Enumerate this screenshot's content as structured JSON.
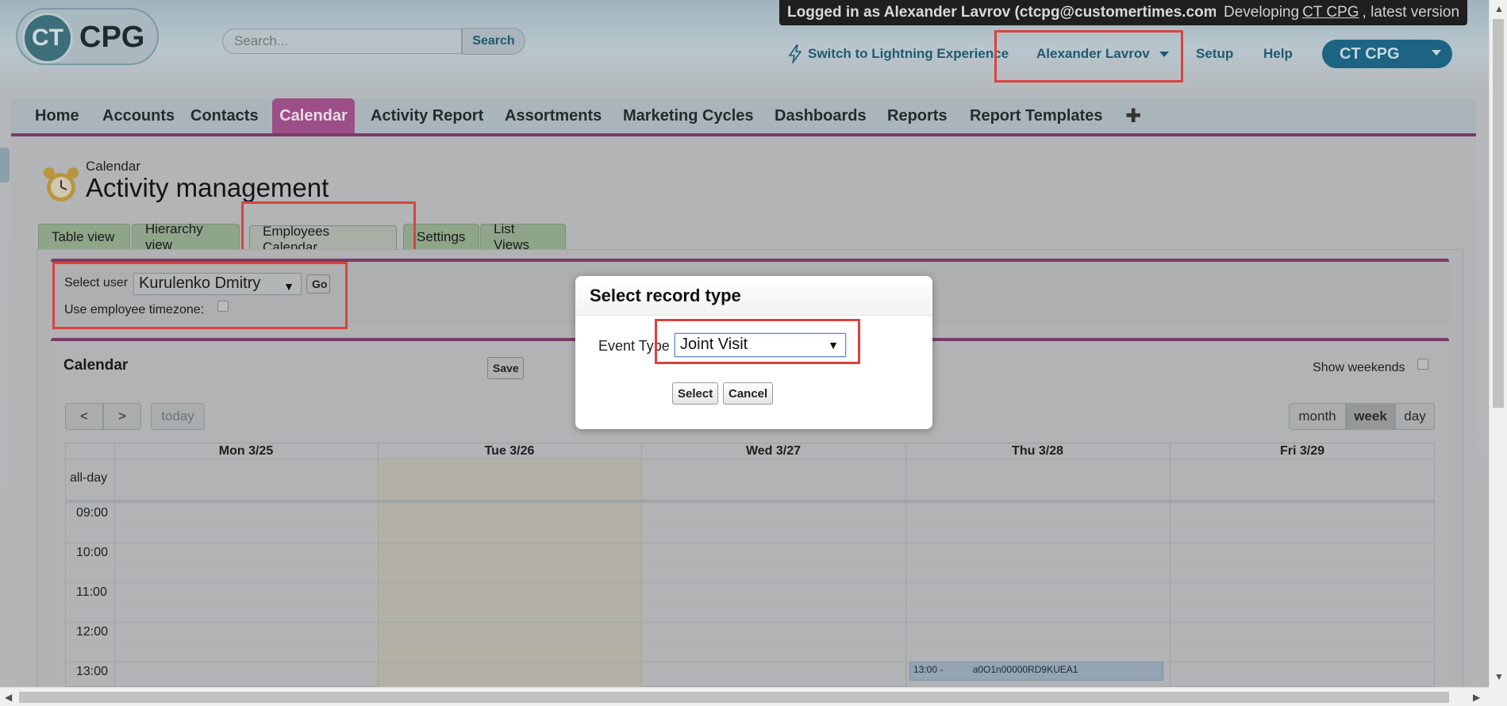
{
  "header": {
    "logo_ct": "CT",
    "logo_cpg": "CPG",
    "search_placeholder": "Search...",
    "search_button": "Search",
    "login_status": "Logged in as Alexander Lavrov (ctcpg@customertimes.com)",
    "dev_prefix": "Developing",
    "dev_app": "CT CPG",
    "dev_suffix": ", latest version",
    "lightning_link": "Switch to Lightning Experience",
    "user_menu": "Alexander Lavrov",
    "setup_link": "Setup",
    "help_link": "Help",
    "app_menu": "CT CPG"
  },
  "nav": {
    "tabs": [
      {
        "label": "Home"
      },
      {
        "label": "Accounts"
      },
      {
        "label": "Contacts"
      },
      {
        "label": "Calendar"
      },
      {
        "label": "Activity Report"
      },
      {
        "label": "Assortments"
      },
      {
        "label": "Marketing Cycles"
      },
      {
        "label": "Dashboards"
      },
      {
        "label": "Reports"
      },
      {
        "label": "Report Templates"
      }
    ],
    "active": "Calendar",
    "plus": "✚"
  },
  "page": {
    "breadcrumb": "Calendar",
    "title": "Activity management",
    "subtabs": [
      {
        "label": "Table view"
      },
      {
        "label": "Hierarchy view"
      },
      {
        "label": "Employees Calendar"
      },
      {
        "label": "Settings"
      },
      {
        "label": "List Views"
      }
    ],
    "active_subtab": "Employees Calendar"
  },
  "user_filter": {
    "select_user_label": "Select user",
    "selected_user": "Kurulenko Dmitry",
    "go_button": "Go",
    "timezone_label": "Use employee timezone:",
    "timezone_checked": false
  },
  "calendar": {
    "title": "Calendar",
    "save_button": "Save",
    "show_weekends_label": "Show weekends",
    "show_weekends_checked": false,
    "prev": "<",
    "next": ">",
    "today": "today",
    "views": [
      "month",
      "week",
      "day"
    ],
    "active_view": "week",
    "allday_label": "all-day",
    "days": [
      "Mon 3/25",
      "Tue 3/26",
      "Wed 3/27",
      "Thu 3/28",
      "Fri 3/29"
    ],
    "times": [
      "09:00",
      "10:00",
      "11:00",
      "12:00",
      "13:00"
    ],
    "event": {
      "time": "13:00 -",
      "title": "a0O1n00000RD9KUEA1",
      "day": "Thu 3/28"
    }
  },
  "modal": {
    "title": "Select record type",
    "event_type_label": "Event Type",
    "event_type_value": "Joint Visit",
    "select_button": "Select",
    "cancel_button": "Cancel"
  },
  "colors": {
    "highlight_box": "#d9433f",
    "nav_active": "#9b4f86",
    "app_button": "#1d6483",
    "link": "#1f5b72"
  }
}
